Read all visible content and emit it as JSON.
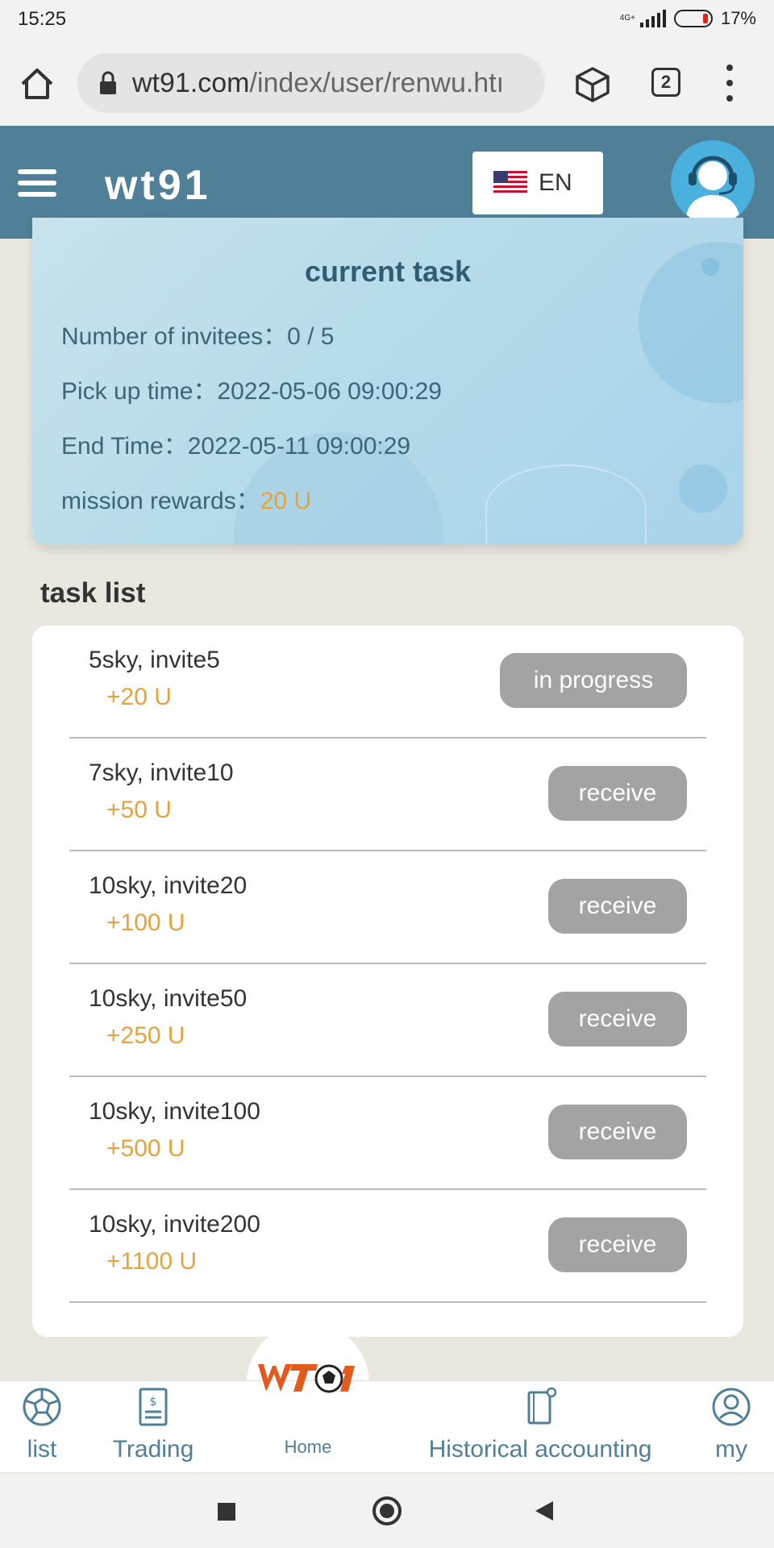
{
  "status_bar": {
    "time": "15:25",
    "network": "4G+",
    "battery": "17%",
    "battery_icon": "battery-icon",
    "signal_icon": "signal-icon"
  },
  "browser": {
    "url_main": "wt91.com",
    "url_path": "/index/user/renwu.htı",
    "tab_count": "2",
    "icons": [
      "home-icon",
      "lock-icon",
      "cube-icon",
      "tabs-icon",
      "more-vert-icon"
    ]
  },
  "header": {
    "brand": "wt91",
    "language": "EN",
    "flag_icon": "us-flag-icon",
    "support_icon": "customer-service-icon",
    "menu_icon": "hamburger-icon",
    "color": "#4f8098"
  },
  "current_task": {
    "title": "current task",
    "invitees_label": "Number of invitees：",
    "invitees_value": "0 / 5",
    "pickup_label": "Pick up time：",
    "pickup_value": "2022-05-06 09:00:29",
    "end_label": "End Time：",
    "end_value": "2022-05-11 09:00:29",
    "reward_label": "mission rewards：",
    "reward_value": "20 U"
  },
  "task_list": {
    "title": "task list",
    "items": [
      {
        "name": "5sky, invite5",
        "amount": "+20 U",
        "button": "in progress"
      },
      {
        "name": "7sky, invite10",
        "amount": "+50 U",
        "button": "receive"
      },
      {
        "name": "10sky, invite20",
        "amount": "+100 U",
        "button": "receive"
      },
      {
        "name": "10sky, invite50",
        "amount": "+250 U",
        "button": "receive"
      },
      {
        "name": "10sky, invite100",
        "amount": "+500 U",
        "button": "receive"
      },
      {
        "name": "10sky, invite200",
        "amount": "+1100 U",
        "button": "receive"
      }
    ]
  },
  "tabbar": {
    "list": "list",
    "trading": "Trading",
    "home": "Home",
    "history": "Historical accounting",
    "my": "my"
  },
  "colors": {
    "accent": "#4f8098",
    "reward": "#e6a23c",
    "button_gray": "#a3a3a3"
  }
}
